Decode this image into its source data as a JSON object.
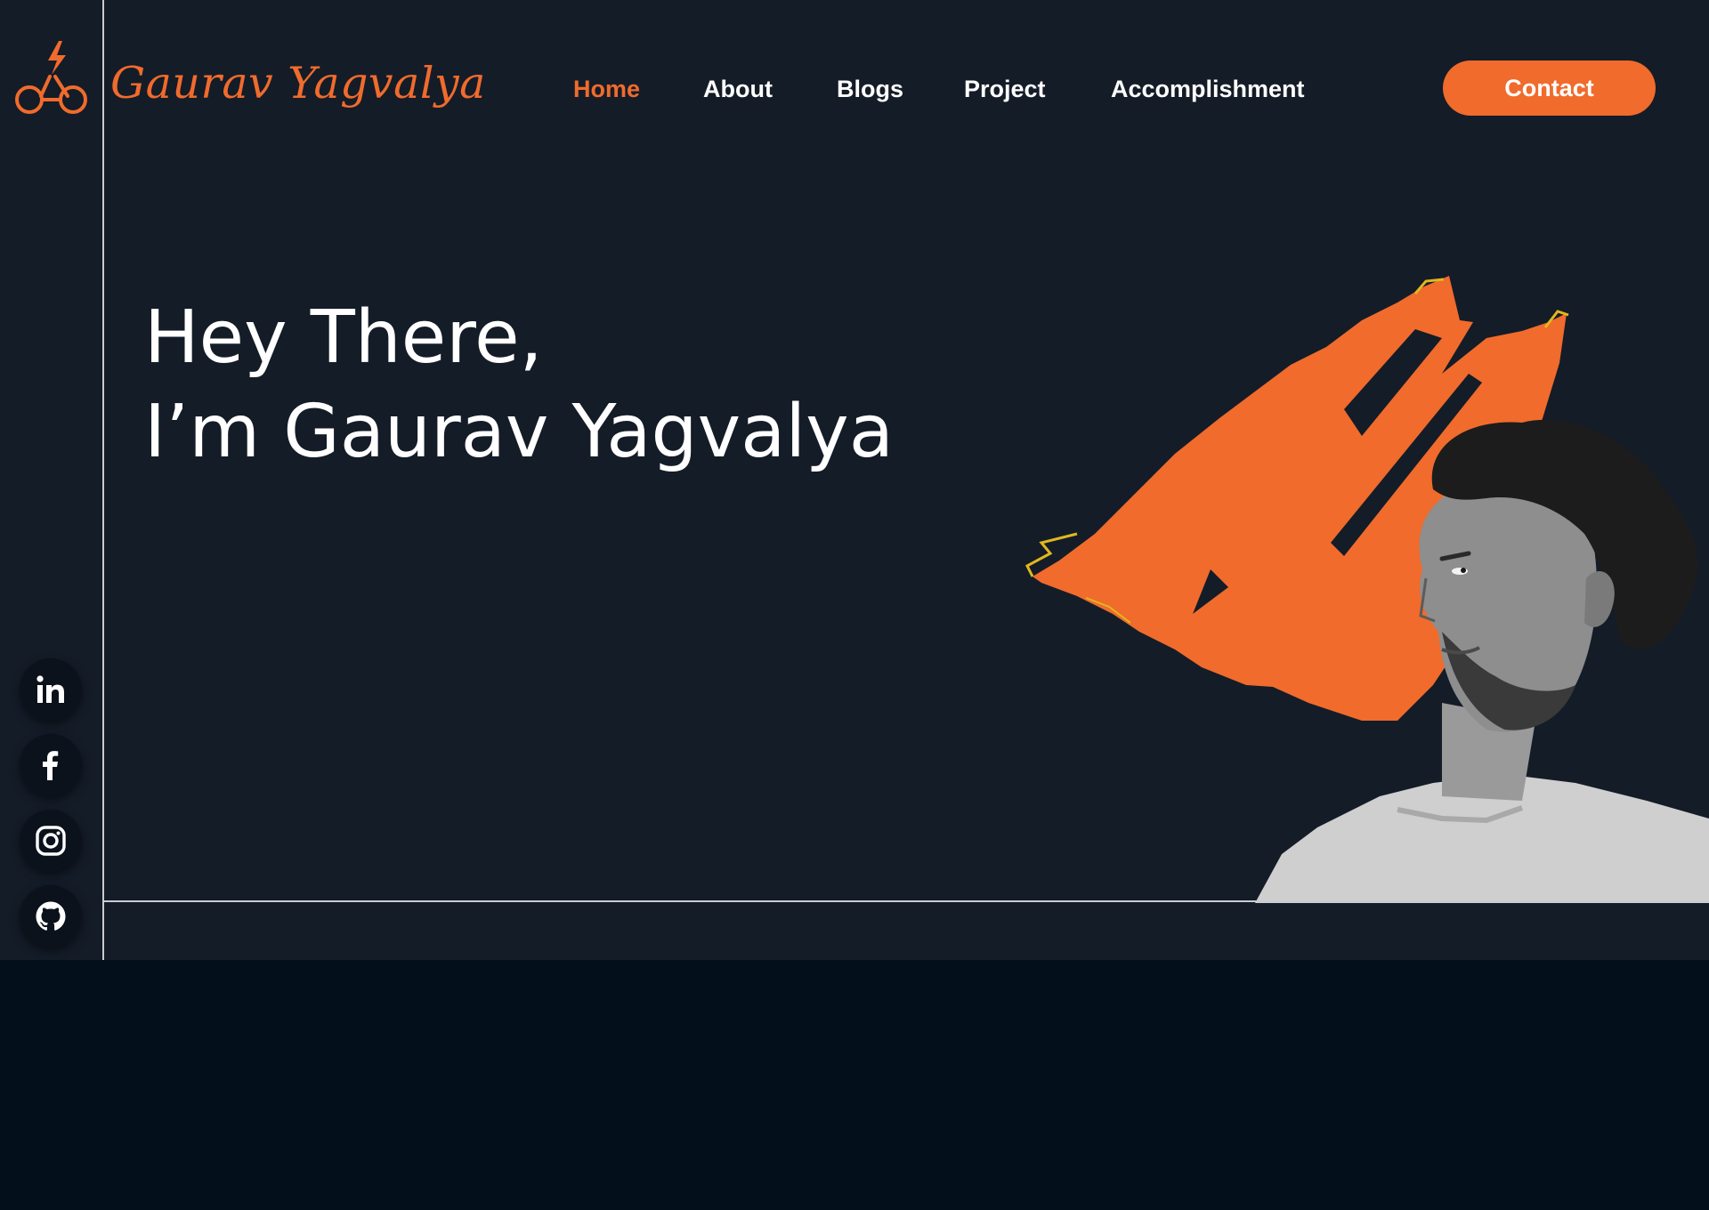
{
  "brand": {
    "name": "Gaurav Yagvalya",
    "logo_icon": "lightning-glasses-icon",
    "accent_color": "#f06b2c"
  },
  "nav": {
    "items": [
      {
        "label": "Home",
        "active": true
      },
      {
        "label": "About",
        "active": false
      },
      {
        "label": "Blogs",
        "active": false
      },
      {
        "label": "Project",
        "active": false
      },
      {
        "label": "Accomplishment",
        "active": false
      }
    ],
    "contact_label": "Contact"
  },
  "hero": {
    "line1": "Hey There,",
    "line2": "I’m Gaurav Yagvalya",
    "portrait": "portrait-photo"
  },
  "socials": [
    {
      "icon": "linkedin-icon"
    },
    {
      "icon": "facebook-icon"
    },
    {
      "icon": "instagram-icon"
    },
    {
      "icon": "github-icon"
    }
  ],
  "colors": {
    "background": "#141c28",
    "lower_background": "#040f1c",
    "accent": "#f06b2c",
    "text": "#ffffff",
    "divider": "#c9ccd1"
  }
}
